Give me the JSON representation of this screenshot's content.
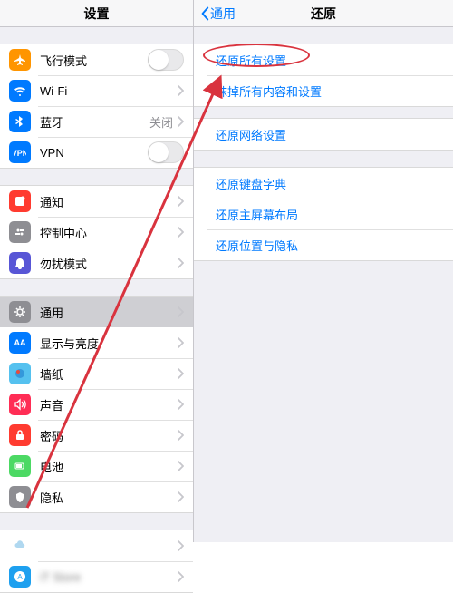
{
  "left": {
    "title": "设置",
    "g1": [
      {
        "icon": "airplane",
        "color": "#ff9500",
        "label": "飞行模式",
        "accessory": "toggle"
      },
      {
        "icon": "wifi",
        "color": "#007aff",
        "label": "Wi-Fi",
        "value": "",
        "accessory": "chevron"
      },
      {
        "icon": "bluetooth",
        "color": "#007aff",
        "label": "蓝牙",
        "value": "关闭",
        "accessory": "chevron"
      },
      {
        "icon": "vpn",
        "color": "#007aff",
        "label": "VPN",
        "accessory": "toggle"
      }
    ],
    "g2": [
      {
        "icon": "notify",
        "color": "#ff3b30",
        "label": "通知"
      },
      {
        "icon": "control",
        "color": "#8e8e93",
        "label": "控制中心"
      },
      {
        "icon": "dnd",
        "color": "#5856d6",
        "label": "勿扰模式"
      }
    ],
    "g3": [
      {
        "icon": "general",
        "color": "#8e8e93",
        "label": "通用",
        "selected": true
      },
      {
        "icon": "display",
        "color": "#007aff",
        "label": "显示与亮度"
      },
      {
        "icon": "wallpaper",
        "color": "#55c1ef",
        "label": "墙纸"
      },
      {
        "icon": "sound",
        "color": "#ff2d55",
        "label": "声音"
      },
      {
        "icon": "passcode",
        "color": "#ff3b30",
        "label": "密码"
      },
      {
        "icon": "battery",
        "color": "#4cd964",
        "label": "电池"
      },
      {
        "icon": "privacy",
        "color": "#8e8e93",
        "label": "隐私"
      }
    ],
    "g4": [
      {
        "icon": "cloud",
        "color": "#fff",
        "label": ""
      },
      {
        "icon": "store",
        "color": "#1ea0ef",
        "label": "iT                      Store"
      }
    ]
  },
  "right": {
    "back": "通用",
    "title": "还原",
    "g1": [
      "还原所有设置",
      "抹掉所有内容和设置"
    ],
    "g2": [
      "还原网络设置"
    ],
    "g3": [
      "还原键盘字典",
      "还原主屏幕布局",
      "还原位置与隐私"
    ]
  }
}
